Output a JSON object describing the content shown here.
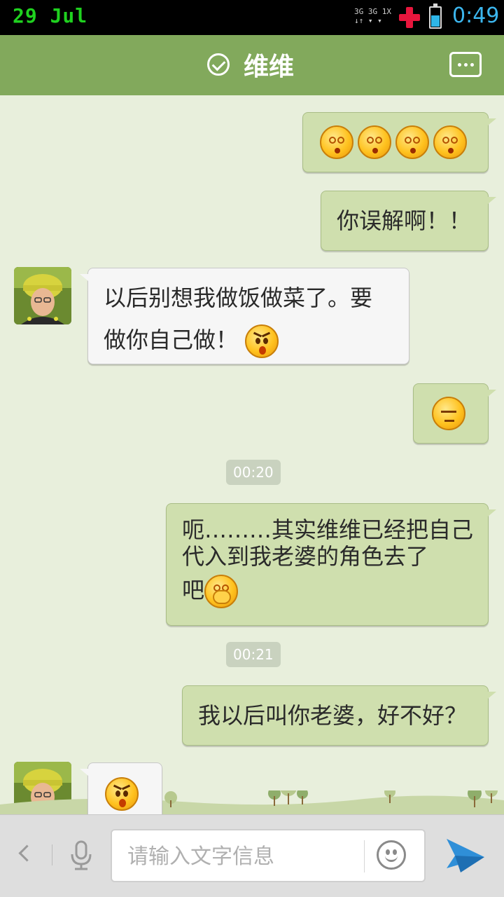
{
  "status_bar": {
    "date": "29  Jul",
    "network_line1": "3G 3G 1X",
    "network_line2": "↓↑ ▾ ▾",
    "time": "0:49",
    "battery_level": 0.55
  },
  "header": {
    "title": "维维",
    "check_icon": "check-circle-icon",
    "more_icon": "more-dots-icon"
  },
  "messages": [
    {
      "side": "right",
      "text": "",
      "emoji": [
        "dizzy",
        "dizzy",
        "dizzy",
        "dizzy"
      ]
    },
    {
      "side": "right",
      "text": "你误解啊！！"
    },
    {
      "side": "left",
      "line1": "以后别想我做饭做菜了。要",
      "line2": "做你自己做！",
      "emoji": [
        "angry"
      ]
    },
    {
      "side": "right",
      "text": "",
      "emoji": [
        "speechless"
      ]
    },
    {
      "side": "right",
      "line1": "呃………其实维维已经把自己",
      "line2": "代入到我老婆的角色去了",
      "line3": "吧",
      "emoji": [
        "shy"
      ]
    },
    {
      "side": "right",
      "text": "我以后叫你老婆，好不好？"
    },
    {
      "side": "left",
      "text": "",
      "emoji": [
        "angry"
      ]
    }
  ],
  "timestamps": [
    "00:20",
    "00:21"
  ],
  "input_bar": {
    "placeholder": "请输入文字信息",
    "icons": [
      "back-icon",
      "microphone-icon",
      "smiley-icon",
      "send-icon"
    ]
  }
}
